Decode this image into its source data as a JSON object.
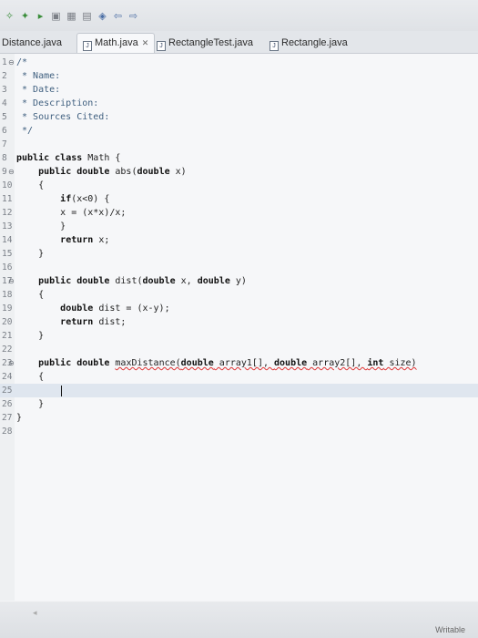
{
  "toolbar": {
    "icons": [
      "pin-icon",
      "run-icon",
      "debug-icon",
      "new-file-icon",
      "save-icon",
      "build-icon",
      "format-icon",
      "nav-back-icon",
      "nav-forward-icon"
    ],
    "glyphs": [
      "✧",
      "✦",
      "▸",
      "▣",
      "▦",
      "▤",
      "◈",
      "⇦",
      "⇨"
    ]
  },
  "tabs": [
    {
      "label": "Distance.java",
      "active": false
    },
    {
      "label": "Math.java",
      "active": true,
      "close": "✕"
    },
    {
      "label": "RectangleTest.java",
      "active": false
    },
    {
      "label": "Rectangle.java",
      "active": false
    }
  ],
  "editor": {
    "lines": [
      {
        "n": "1",
        "fold": "⊖",
        "code": "/*"
      },
      {
        "n": "2",
        "code": " * Name:"
      },
      {
        "n": "3",
        "code": " * Date:"
      },
      {
        "n": "4",
        "code": " * Description:"
      },
      {
        "n": "5",
        "code": " * Sources Cited:"
      },
      {
        "n": "6",
        "code": " */"
      },
      {
        "n": "7",
        "code": ""
      },
      {
        "n": "8",
        "code": "public class Math {"
      },
      {
        "n": "9",
        "fold": "⊖",
        "code": "    public double abs(double x)"
      },
      {
        "n": "10",
        "code": "    {"
      },
      {
        "n": "11",
        "code": "        if(x<0) {"
      },
      {
        "n": "12",
        "code": "        x = (x*x)/x;"
      },
      {
        "n": "13",
        "code": "        }"
      },
      {
        "n": "14",
        "code": "        return x;"
      },
      {
        "n": "15",
        "code": "    }"
      },
      {
        "n": "16",
        "code": ""
      },
      {
        "n": "17",
        "fold": "⊖",
        "code": "    public double dist(double x, double y)"
      },
      {
        "n": "18",
        "code": "    {"
      },
      {
        "n": "19",
        "code": "        double dist = (x-y);"
      },
      {
        "n": "20",
        "code": "        return dist;"
      },
      {
        "n": "21",
        "code": "    }"
      },
      {
        "n": "22",
        "code": ""
      },
      {
        "n": "23",
        "fold": "⊖",
        "code": "    public double maxDistance(double array1[], double array2[], int size)"
      },
      {
        "n": "24",
        "code": "    {"
      },
      {
        "n": "25",
        "code": ""
      },
      {
        "n": "26",
        "code": "    }"
      },
      {
        "n": "27",
        "code": "}"
      },
      {
        "n": "28",
        "code": ""
      }
    ]
  },
  "status": {
    "writable": "Writable"
  }
}
